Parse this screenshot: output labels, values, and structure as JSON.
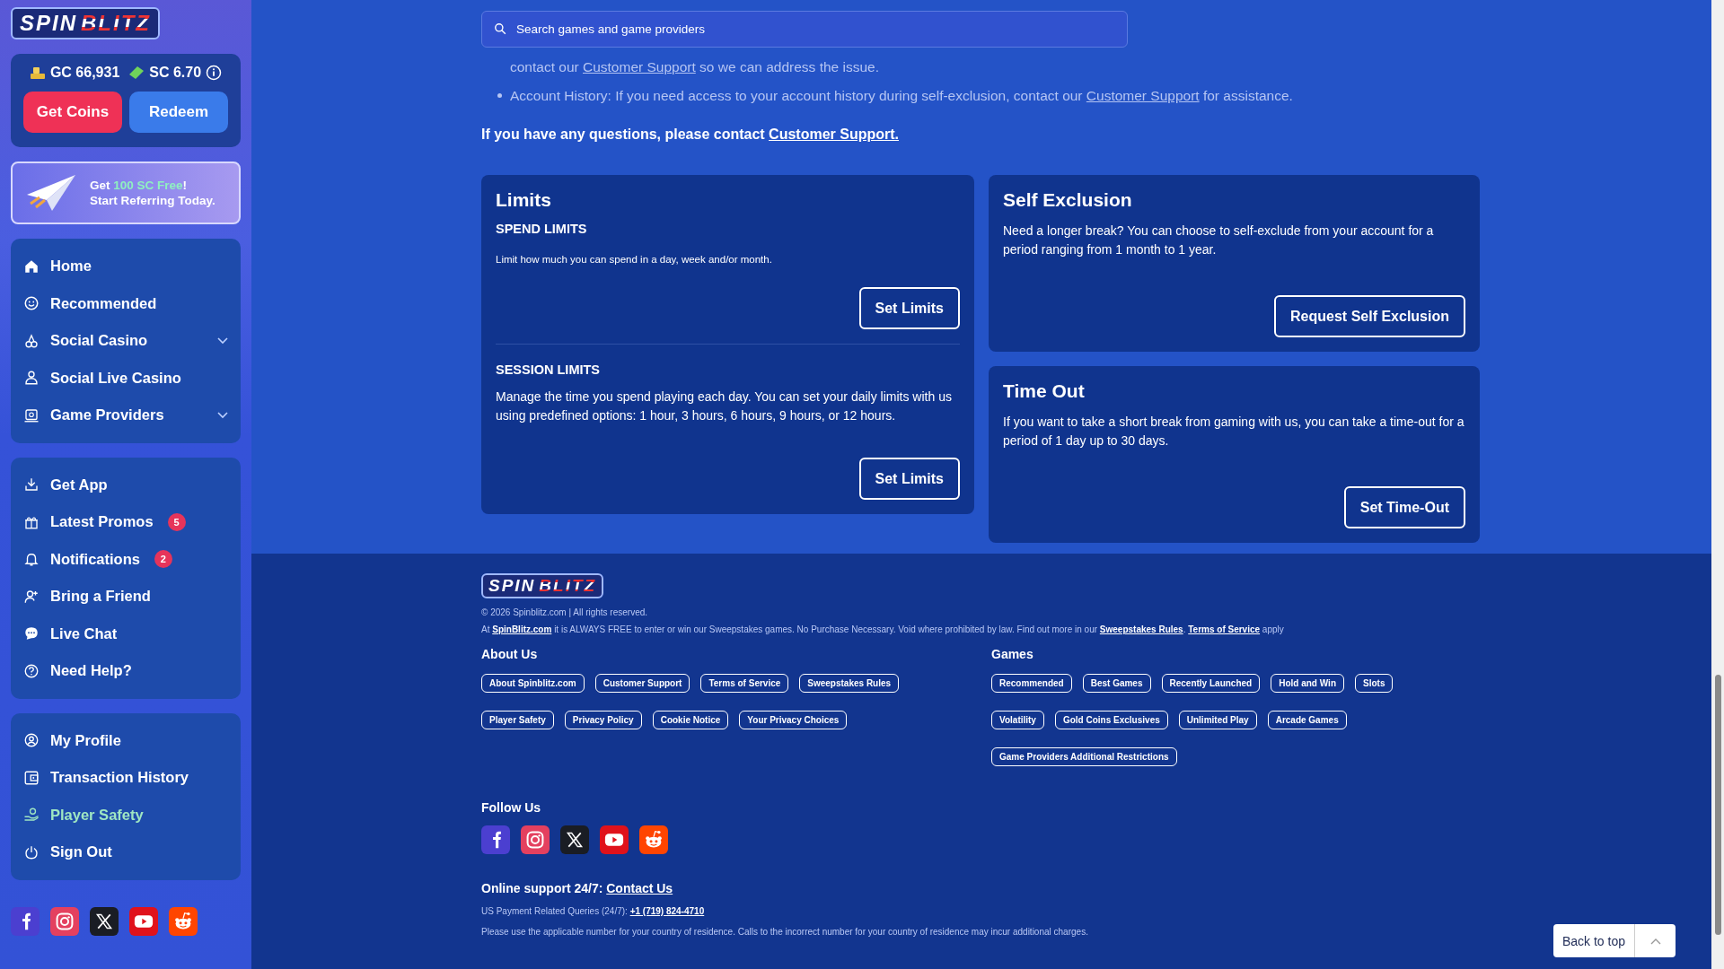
{
  "sidebar_logo": {
    "word1": "SPIN",
    "word2": "BLITZ"
  },
  "wallet": {
    "gc": "GC 66,931",
    "sc": "SC 6.70",
    "buttons": [
      {
        "label": "Get Coins",
        "kind": "primary"
      },
      {
        "label": "Redeem",
        "kind": "secondary"
      }
    ]
  },
  "referral": {
    "parts": [
      {
        "text": "Get "
      },
      {
        "highlight": "100 SC Free"
      },
      {
        "text": "!"
      }
    ],
    "line2": "Start Referring Today."
  },
  "nav_groups": [
    [
      {
        "label": "Home",
        "selected": false
      },
      {
        "label": "Recommended",
        "selected": false
      },
      {
        "label": "Social Casino",
        "selected": false,
        "expanded": false
      },
      {
        "label": "Social Live Casino",
        "selected": false
      },
      {
        "label": "Game Providers",
        "selected": false,
        "expanded": false
      }
    ],
    [
      {
        "label": "Get App",
        "selected": false
      },
      {
        "label": "Latest Promos",
        "selected": false,
        "badge": "5"
      },
      {
        "label": "Notifications",
        "selected": false,
        "badge": "2"
      },
      {
        "label": "Bring a Friend",
        "selected": false
      },
      {
        "label": "Live Chat",
        "selected": false
      },
      {
        "label": "Need Help?",
        "selected": false
      }
    ],
    [
      {
        "label": "My Profile",
        "selected": false
      },
      {
        "label": "Transaction History",
        "selected": false
      },
      {
        "label": "Player Safety",
        "selected": true
      },
      {
        "label": "Sign Out",
        "selected": false
      }
    ]
  ],
  "sidebar_socials": [
    {
      "kind": "facebook"
    },
    {
      "kind": "instagram"
    },
    {
      "kind": "x"
    },
    {
      "kind": "youtube"
    },
    {
      "kind": "reddit"
    }
  ],
  "search": {
    "placeholder": "Search games and game providers"
  },
  "intro": [
    {
      "bullet": false,
      "parts": [
        {
          "text": "contact our "
        },
        {
          "link": "Customer Support"
        },
        {
          "text": " so we can address the issue."
        }
      ]
    },
    {
      "bullet": true,
      "parts": [
        {
          "text": "Account History: If you need access to your account history during self-exclusion, contact our "
        },
        {
          "link": "Customer Support"
        },
        {
          "text": " for assistance."
        }
      ]
    }
  ],
  "questions": {
    "text": "If you have any questions, please contact ",
    "link": "Customer Support."
  },
  "limits": {
    "title": "Limits",
    "sections": [
      {
        "heading": "SPEND LIMITS",
        "text": "Limit how much you can spend in a day, week and/or month.",
        "button": "Set Limits"
      },
      {
        "heading": "SESSION LIMITS",
        "text": "Manage the time you spend playing each day. You can set your daily limits with us using predefined options: 1 hour, 3 hours, 6 hours, 9 hours, or 12 hours.",
        "button": "Set Limits"
      }
    ]
  },
  "side_cards": [
    {
      "title": "Self Exclusion",
      "text": "Need a longer break? You can choose to self-exclude from your account for a period ranging from 1 month to 1 year.",
      "button": "Request Self Exclusion"
    },
    {
      "title": "Time Out",
      "text": "If you want to take a short break from gaming with us, you can take a time-out for a period of 1 day up to 30 days.",
      "button": "Set Time-Out"
    }
  ],
  "footer": {
    "logo": {
      "word1": "SPIN",
      "word2": "BLITZ"
    },
    "copyright": "© 2026 Spinblitz.com | All rights reserved.",
    "free_line": [
      {
        "text": "At "
      },
      {
        "link": "SpinBlitz.com"
      },
      {
        "text": " it is ALWAYS FREE to enter or win our Sweepstakes games. No Purchase Necessary. Void where prohibited by law. Find out more in our "
      },
      {
        "link": "Sweepstakes Rules"
      },
      {
        "text": ". "
      },
      {
        "link": "Terms of Service"
      },
      {
        "text": " apply"
      }
    ],
    "columns": [
      {
        "title": "About Us",
        "links": [
          "About Spinblitz.com",
          "Customer Support",
          "Terms of Service",
          "Sweepstakes Rules",
          "Player Safety",
          "Privacy Policy",
          "Cookie Notice",
          "Your Privacy Choices"
        ]
      },
      {
        "title": "Games",
        "links": [
          "Recommended",
          "Best Games",
          "Recently Launched",
          "Hold and Win",
          "Slots",
          "Volatility",
          "Gold Coins Exclusives",
          "Unlimited Play",
          "Arcade Games",
          "Game Providers Additional Restrictions"
        ]
      }
    ],
    "follow_title": "Follow Us",
    "socials": [
      {
        "kind": "facebook"
      },
      {
        "kind": "instagram"
      },
      {
        "kind": "x"
      },
      {
        "kind": "youtube"
      },
      {
        "kind": "reddit"
      }
    ],
    "support": {
      "text": "Online support 24/7: ",
      "link": "Contact Us"
    },
    "payment": {
      "text": "US Payment Related Queries (24/7): ",
      "link": "+1 (719) 824-4710"
    },
    "notice": "Please use the applicable number for your country of residence. Calls to the incorrect number for your country of residence may incur additional charges."
  },
  "back_to_top": {
    "label": "Back to top"
  }
}
